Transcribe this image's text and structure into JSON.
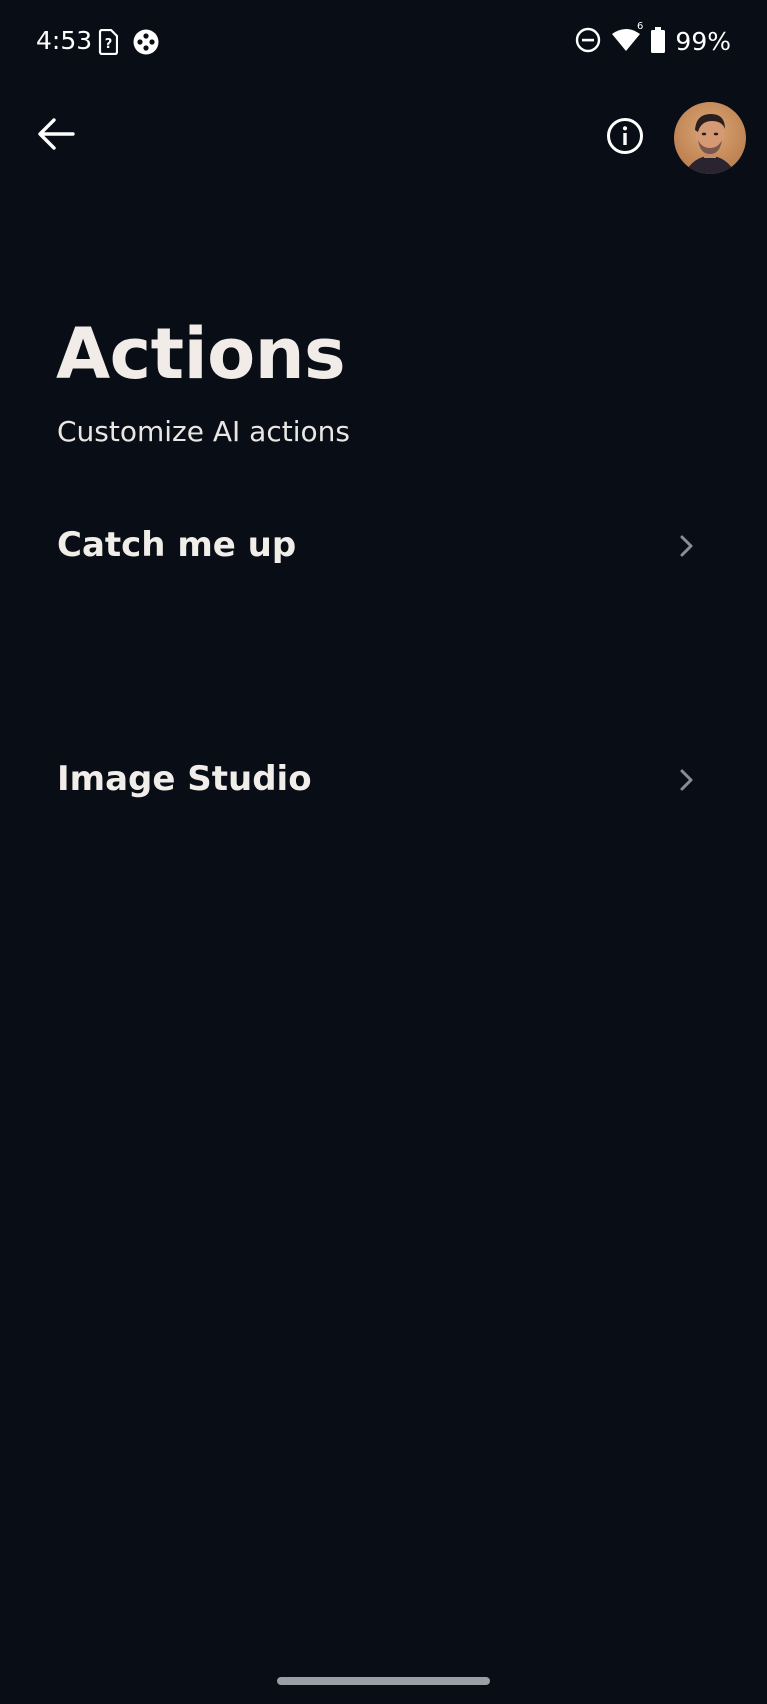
{
  "status_bar": {
    "time": "4:53",
    "battery_percent": "99%",
    "icons": [
      "sim-card-icon",
      "game-controller-icon",
      "do-not-disturb-icon",
      "wifi-icon",
      "battery-icon"
    ],
    "wifi_badge": "6"
  },
  "top_bar": {
    "back_icon": "arrow-left-icon",
    "info_icon": "info-icon",
    "avatar": "user-avatar"
  },
  "page": {
    "title": "Actions",
    "subtitle": "Customize AI actions"
  },
  "actions": [
    {
      "label": "Catch me up",
      "icon": "chevron-right-icon"
    },
    {
      "label": "Image Studio",
      "icon": "chevron-right-icon"
    }
  ],
  "colors": {
    "background": "#080d16",
    "text": "#f1ece8",
    "chevron": "#8a8d93"
  }
}
